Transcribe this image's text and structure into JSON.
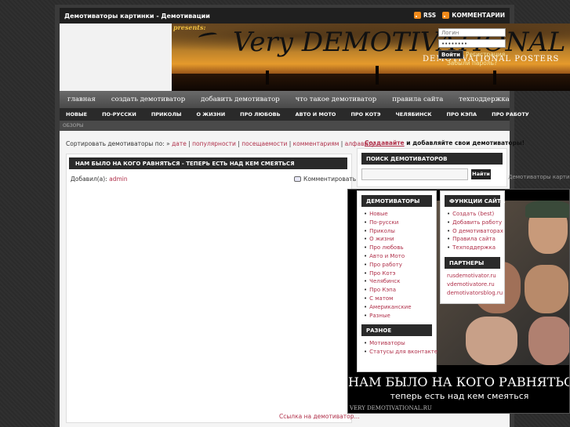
{
  "header": {
    "site_title": "Демотиваторы картинки - Демотивации",
    "rss_label": "RSS",
    "comments_label": "КОММЕНТАРИИ"
  },
  "banner": {
    "presents": "presents:",
    "logo_main": "Very DEMOTIVATIONAL",
    "logo_sub": "DEMOTIVATIONAL POSTERS"
  },
  "login": {
    "login_placeholder": "Логин",
    "password_value": "••••••••",
    "login_button": "Войти",
    "register_link": "Регистрация",
    "forgot_link": "Забыли пароль?"
  },
  "nav_main": [
    "главная",
    "создать демотиватор",
    "добавить демотиватор",
    "что такое демотиватор",
    "правила сайта",
    "техподдержка"
  ],
  "nav_categories": [
    "НОВЫЕ",
    "ПО-РУССКИ",
    "ПРИКОЛЫ",
    "О ЖИЗНИ",
    "ПРО ЛЮБОВЬ",
    "АВТО И МОТО",
    "ПРО КОТЭ",
    "ЧЕЛЯБИНСК",
    "ПРО КЭПА",
    "ПРО РАБОТУ"
  ],
  "thin_bar_text": "ОБЗОРЫ",
  "sort": {
    "prefix": "Сортировать демотиваторы по: ",
    "arrow": "» ",
    "options": [
      "дате",
      "популярности",
      "посещаемости",
      "комментариям",
      "алфавиту"
    ]
  },
  "create_cta": {
    "link": "Создавайте",
    "rest": " и добавляйте свои демотиваторы!"
  },
  "post": {
    "title": "НАМ БЫЛО НА КОГО РАВНЯТЬСЯ - ТЕПЕРЬ ЕСТЬ НАД КЕМ СМЕЯТЬСЯ",
    "added_by_label": "Добавил(а): ",
    "author": "admin",
    "comments_link": "Комментировать",
    "permalink": "Ссылка на демотиватор..."
  },
  "search": {
    "heading": "ПОИСК ДЕМОТИВАТОРОВ",
    "button": "Найти",
    "ghost_text": "Демотиваторы картинки"
  },
  "demotivator": {
    "caption_big": "НАМ БЫЛО НА КОГО РАВНЯТЬСЯ",
    "caption_small": "теперь есть над кем смеяться",
    "source": "VERY DEMOTIVATIONAL.RU"
  },
  "sidebar_demotivators": {
    "heading": "ДЕМОТИВАТОРЫ",
    "items": [
      "Новые",
      "По-русски",
      "Приколы",
      "О жизни",
      "Про любовь",
      "Авто и Мото",
      "Про работу",
      "Про Котэ",
      "Челябинск",
      "Про Кэпа",
      "С матом",
      "Американские",
      "Разные"
    ]
  },
  "sidebar_misc": {
    "heading": "РАЗНОЕ",
    "items": [
      "Мотиваторы",
      "Статусы для вконтакте"
    ]
  },
  "sidebar_functions": {
    "heading": "ФУНКЦИИ САЙТА",
    "items": [
      "Создать (best)",
      "Добавить работу",
      "О демотиваторах",
      "Правила сайта",
      "Техподдержка"
    ]
  },
  "sidebar_partners": {
    "heading": "ПАРТНЕРЫ",
    "items": [
      "rusdemotivator.ru",
      "vdemotivatore.ru",
      "demotivatorsblog.ru"
    ]
  },
  "colors": {
    "accent_link": "#b0304a",
    "dark_bar": "#2a2a2a",
    "rss_orange": "#f08a1a"
  }
}
